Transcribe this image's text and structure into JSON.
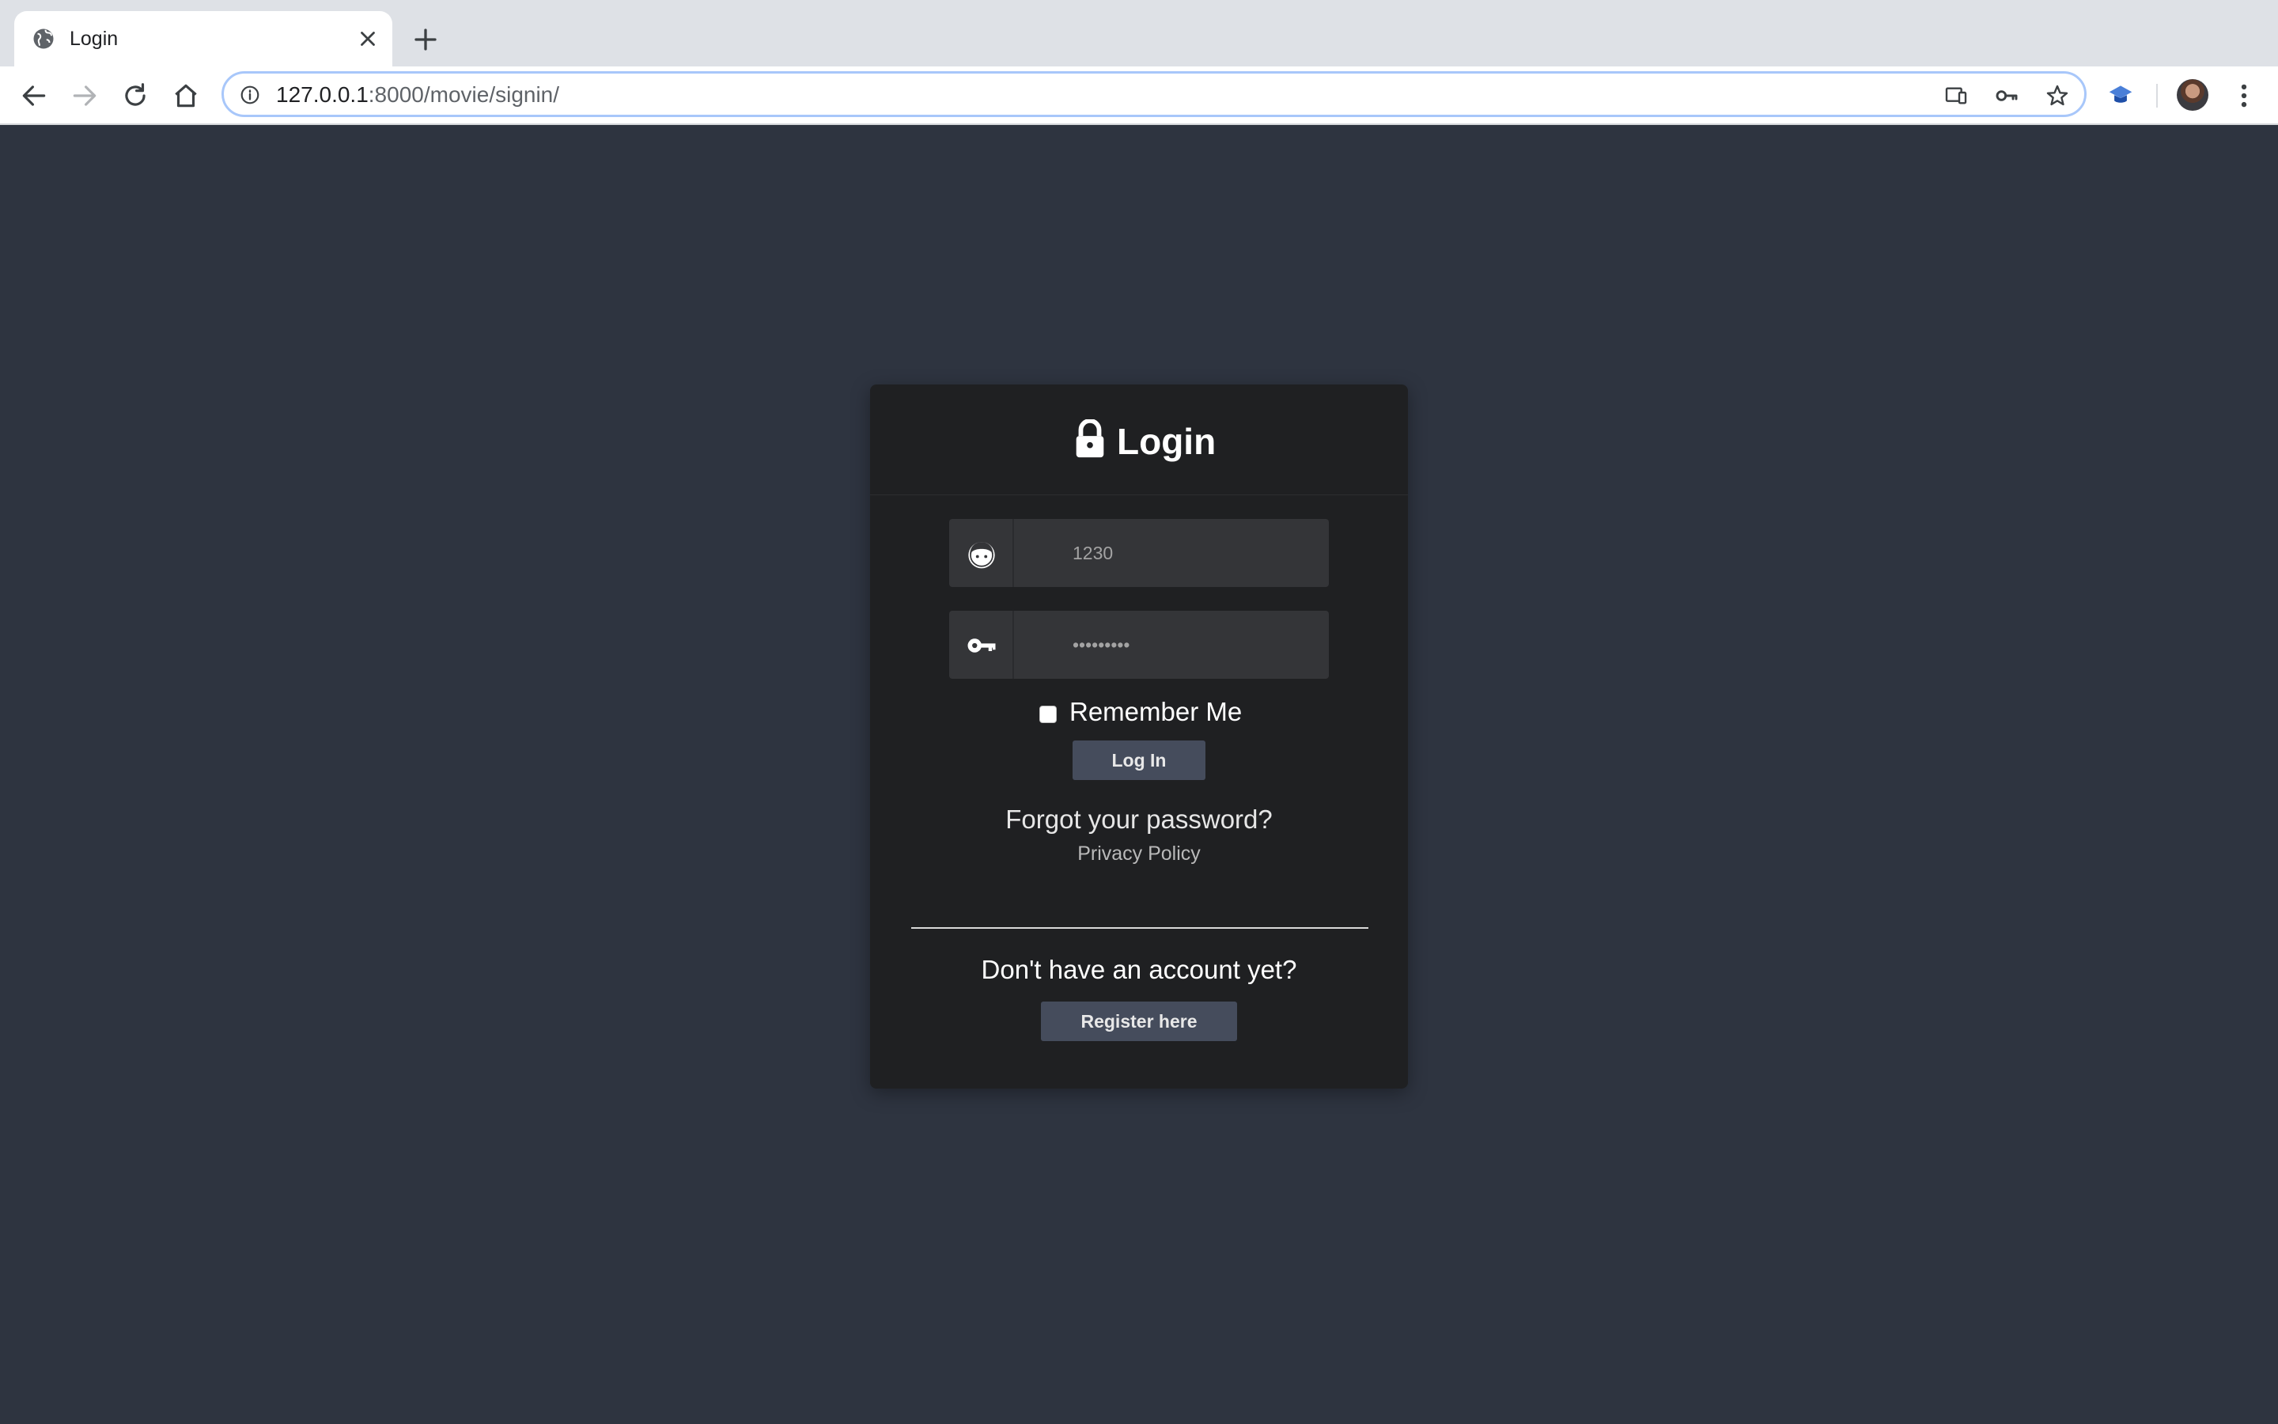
{
  "browser": {
    "tab": {
      "title": "Login",
      "favicon": "globe-icon"
    },
    "address": {
      "host": "127.0.0.1",
      "rest": ":8000/movie/signin/"
    },
    "toolbar_icons": [
      "back-icon",
      "forward-icon",
      "reload-icon",
      "home-icon",
      "info-icon",
      "cast-icon",
      "key-icon",
      "star-icon",
      "extension-icon",
      "avatar",
      "menu-icon"
    ]
  },
  "login_card": {
    "title": "Login",
    "title_icon": "lock-icon",
    "username": {
      "icon": "user-face-icon",
      "placeholder": "1230",
      "value": ""
    },
    "password": {
      "icon": "key-icon",
      "placeholder": "•••••••••",
      "value": ""
    },
    "remember_me": {
      "label": "Remember Me",
      "checked": false
    },
    "login_button": "Log In",
    "forgot_password": "Forgot your password?",
    "privacy_policy": "Privacy Policy",
    "no_account_text": "Don't have an account yet?",
    "register_button": "Register here"
  },
  "colors": {
    "page_background": "#2e3440",
    "card_background": "#1f2022",
    "input_background": "#343538",
    "button_background": "#454c5c",
    "omnibox_focus": "#a8c7fa"
  }
}
